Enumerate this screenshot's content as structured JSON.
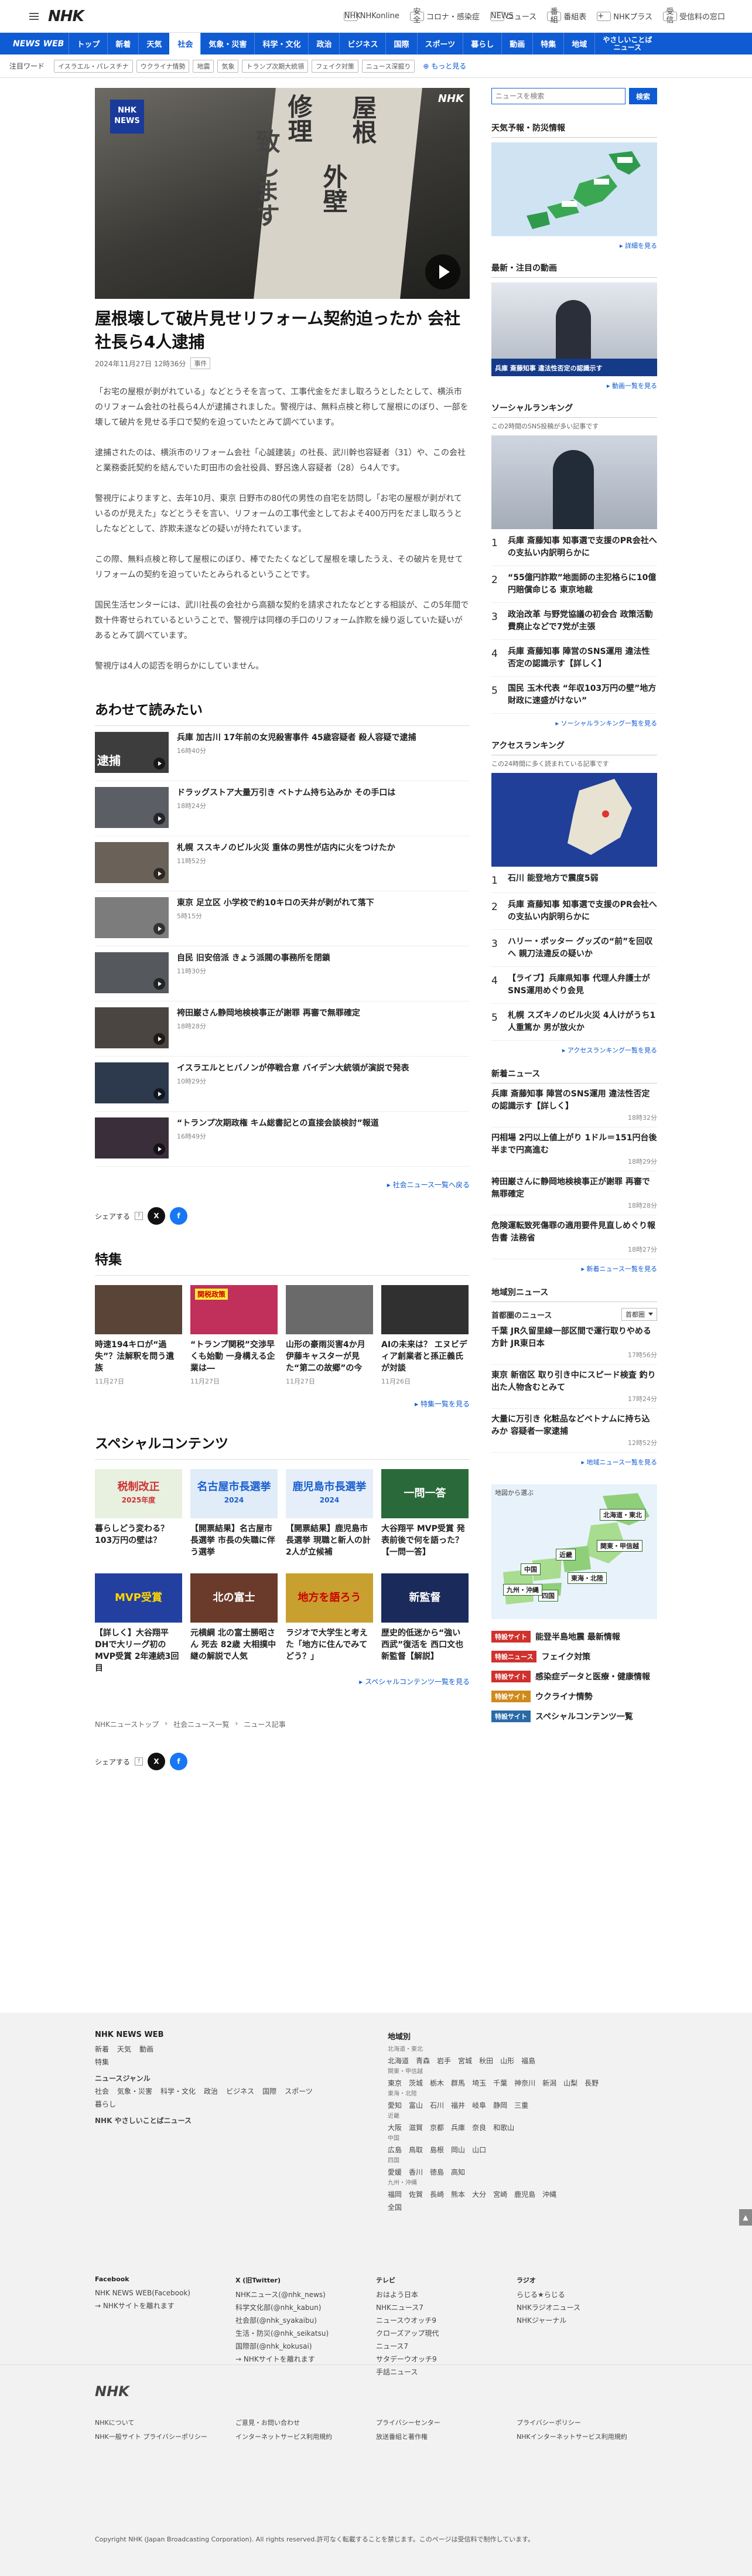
{
  "header": {
    "logo": "NHK",
    "links": [
      {
        "icon": "NHK",
        "label": "NHKonline"
      },
      {
        "icon": "安全",
        "label": "コロナ・感染症"
      },
      {
        "icon": "NEWS",
        "label": "ニュース"
      },
      {
        "icon": "番組",
        "label": "番組表"
      },
      {
        "icon": "+",
        "label": "NHKプラス"
      },
      {
        "icon": "受信",
        "label": "受信料の窓口"
      }
    ]
  },
  "nav": {
    "brand": "NEWS WEB",
    "items": [
      "トップ",
      "新着",
      "天気",
      "社会",
      "気象・災害",
      "科学・文化",
      "政治",
      "ビジネス",
      "国際",
      "スポーツ",
      "暮らし",
      "動画",
      "特集",
      "地域"
    ],
    "selected_index": 3,
    "easy": "やさしいことば\nニュース"
  },
  "trend": {
    "label": "注目ワード",
    "tags": [
      "イスラエル・パレスチナ",
      "ウクライナ情勢",
      "地震",
      "気象",
      "トランプ次期大統領",
      "フェイク対策",
      "ニュース深掘り"
    ],
    "more": "もっと見る"
  },
  "article": {
    "title": "屋根壊して破片見せリフォーム契約迫ったか 会社社長ら4人逮捕",
    "date": "2024年11月27日 12時36分",
    "category": "事件",
    "paragraphs": [
      "「お宅の屋根が剥がれている」などとうそを言って、工事代金をだまし取ろうとしたとして、横浜市のリフォーム会社の社長ら4人が逮捕されました。警視庁は、無料点検と称して屋根にのぼり、一部を壊して破片を見せる手口で契約を迫っていたとみて調べています。",
      "逮捕されたのは、横浜市のリフォーム会社「心誠建装」の社長、武川幹也容疑者（31）や、この会社と業務委託契約を結んでいた町田市の会社役員、野呂逸人容疑者（28）ら4人です。",
      "警視庁によりますと、去年10月、東京 日野市の80代の男性の自宅を訪問し「お宅の屋根が剥がれているのが見えた」などとうそを言い、リフォームの工事代金としておよそ400万円をだまし取ろうとしたなどとして、詐欺未遂などの疑いが持たれています。",
      "この際、無料点検と称して屋根にのぼり、棒でたたくなどして屋根を壊したうえ、その破片を見せてリフォームの契約を迫っていたとみられるということです。",
      "国民生活センターには、武川社長の会社から高額な契約を請求されたなどとする相談が、この5年間で数十件寄せられているということで、警視庁は同様の手口のリフォーム詐欺を繰り返していた疑いがあるとみて調べています。",
      "警視庁は4人の認否を明らかにしていません。"
    ],
    "hero_text": [
      "屋根",
      "外壁",
      "修理",
      "致します"
    ],
    "hero_wm": "NHK"
  },
  "related": {
    "heading": "あわせて読みたい",
    "items": [
      {
        "title": "兵庫 加古川 17年前の女児殺害事件 45歳容疑者 殺人容疑で逮捕",
        "date": "16時40分",
        "label": "逮捕"
      },
      {
        "title": "ドラッグストア大量万引き ベトナム持ち込みか その手口は",
        "date": "18時24分"
      },
      {
        "title": "札幌 ススキノのビル火災 重体の男性が店内に火をつけたか",
        "date": "11時52分"
      },
      {
        "title": "東京 足立区 小学校で約10キロの天井が剥がれて落下",
        "date": "5時15分"
      },
      {
        "title": "自民 旧安倍派 きょう派閥の事務所を閉鎖",
        "date": "11時30分"
      },
      {
        "title": "袴田巌さん静岡地検検事正が謝罪 再審で無罪確定",
        "date": "18時28分"
      },
      {
        "title": "イスラエルとヒバノンが停戦合意 バイデン大統領が演説で発表",
        "date": "10時29分"
      },
      {
        "title": "“トランプ次期政権 キム総書記との直接会談検討”報道",
        "date": "16時49分"
      }
    ],
    "more": "社会ニュース一覧へ戻る"
  },
  "share": {
    "label": "シェアする",
    "q": "?"
  },
  "features": {
    "heading": "特集",
    "items": [
      {
        "title": "時速194キロが“過失”？法解釈を問う遺族",
        "date": "11月27日"
      },
      {
        "title": "“トランプ関税”交渉早くも始動 一身構える企業は―",
        "date": "11月27日",
        "label": "関税政策"
      },
      {
        "title": "山形の豪雨災害4か月 伊藤キャスターが見た“第二の故郷”の今",
        "date": "11月27日"
      },
      {
        "title": "AIの未来は？ エヌビディア創業者と孫正義氏が対談",
        "date": "11月26日"
      }
    ],
    "more": "特集一覧を見る"
  },
  "special": {
    "heading": "スペシャルコンテンツ",
    "items": [
      {
        "title": "暮らしどう変わる？ 103万円の壁は？",
        "thumb": "税制改正",
        "sub": "2025年度"
      },
      {
        "title": "【開票結果】名古屋市長選挙 市長の失職に伴う選挙",
        "thumb": "名古屋市長選挙",
        "sub": "2024"
      },
      {
        "title": "【開票結果】鹿児島市長選挙 現職と新人の計2人が立候補",
        "thumb": "鹿児島市長選挙",
        "sub": "2024"
      },
      {
        "title": "大谷翔平 MVP受賞 発表前後で何を語った？【一問一答】",
        "thumb": "一問一答"
      },
      {
        "title": "【詳しく】大谷翔平 DHで大リーグ初のMVP受賞 2年連続3回目",
        "thumb": "MVP受賞"
      },
      {
        "title": "元横綱 北の富士勝昭さん 死去 82歳 大相撲中継の解説で人気",
        "thumb": "北の富士"
      },
      {
        "title": "ラジオで大学生と考えた「地方に住んでみてどう？」",
        "thumb": "地方を語ろう"
      },
      {
        "title": "歴史的低迷から“強い西武”復活を 西口文也新監督【解説】",
        "thumb": "新監督"
      }
    ],
    "more": "スペシャルコンテンツ一覧を見る"
  },
  "breadcrumb": [
    "NHKニューストップ",
    "社会ニュース一覧",
    "ニュース記事"
  ],
  "side": {
    "search_placeholder": "ニュースを検索",
    "search_btn": "検索",
    "weather": {
      "title": "天気予報・防災情報",
      "more": "詳細を見る"
    },
    "video": {
      "title": "最新・注目の動画",
      "caption": "兵庫 斎藤知事 違法性否定の認識示す",
      "more": "動画一覧を見る"
    },
    "social": {
      "title": "ソーシャルランキング",
      "note": "この2時間のSNS投稿が多い記事です",
      "items": [
        "兵庫 斎藤知事 知事選で支援のPR会社への支払い内訳明らかに",
        "“55億円詐欺”地面師の主犯格らに10億円賠償命じる 東京地裁",
        "政治改革 与野党協議の初会合 政策活動費廃止などで7党が主張",
        "兵庫 斎藤知事 陣営のSNS運用 違法性否定の認識示す【詳しく】",
        "国民 玉木代表 “年収103万円の壁”地方財政に速盛がけない”"
      ],
      "more": "ソーシャルランキング一覧を見る"
    },
    "access": {
      "title": "アクセスランキング",
      "note": "この24時間に多く読まれている記事です",
      "items": [
        "石川 能登地方で震度5弱",
        "兵庫 斎藤知事 知事選で支援のPR会社への支払い内訳明らかに",
        "ハリー・ポッター グッズの“前”を回収へ 親刀法違反の疑いか",
        "【ライブ】兵庫県知事 代理人弁護士がSNS運用めぐり会見",
        "札幌 スズキノのビル火災 4人けがうち1人重篤か 男が放火か"
      ],
      "more": "アクセスランキング一覧を見る"
    },
    "latest": {
      "title": "新着ニュース",
      "items": [
        {
          "title": "兵庫 斎藤知事 陣営のSNS運用 違法性否定の認識示す【詳しく】",
          "date": "18時32分"
        },
        {
          "title": "円相場 2円以上値上がり 1ドル＝151円台後半まで円高進む",
          "date": "18時29分"
        },
        {
          "title": "袴田巌さんに静岡地検検事正が謝罪 再審で無罪確定",
          "date": "18時28分"
        },
        {
          "title": "危険運転致死傷罪の適用要件見直しめぐり報告書 法務省",
          "date": "18時27分"
        }
      ],
      "more": "新着ニュース一覧を見る"
    },
    "regional": {
      "title": "地域別ニュース",
      "area": "首都圏のニュース",
      "select": "首都圏",
      "items": [
        {
          "title": "千葉 JR久留里線一部区間で運行取りやめる方針 JR東日本",
          "date": "17時56分"
        },
        {
          "title": "東京 新宿区 取り引き中にスピード検査 釣り出た人物含むとみて",
          "date": "17時24分"
        },
        {
          "title": "大量に万引き 化粧品などベトナムに持ち込みか 容疑者一家逮捕",
          "date": "12時52分"
        }
      ],
      "more": "地域ニュース一覧を見る"
    },
    "map_note": "地図から選ぶ",
    "map_regions": [
      "北海道・東北",
      "関東・甲信越",
      "東海・北陸",
      "近畿",
      "中国",
      "四国",
      "九州・沖縄"
    ],
    "topics": [
      {
        "badge": "特設サイト",
        "badge_color": "#d0312d",
        "title": "能登半島地震 最新情報"
      },
      {
        "badge": "特設ニュース",
        "badge_color": "#d0312d",
        "title": "フェイク対策"
      },
      {
        "badge": "特設サイト",
        "badge_color": "#d0312d",
        "title": "感染症データと医療・健康情報"
      },
      {
        "badge": "特設サイト",
        "badge_color": "#d08a1c",
        "title": "ウクライナ情勢"
      },
      {
        "badge": "特設サイト",
        "badge_color": "#2a6aa8",
        "title": "スペシャルコンテンツ一覧"
      }
    ]
  },
  "footer": {
    "left_title": "NHK NEWS WEB",
    "left_rows": [
      [
        "新着",
        "天気",
        "動画"
      ],
      [
        "特集"
      ],
      [
        "ニュースジャンル"
      ],
      [
        "社会",
        "気象・災害",
        "科学・文化",
        "政治",
        "ビジネス",
        "国際",
        "スポーツ"
      ],
      [
        "暮らし"
      ],
      [
        "NHK やさしいことばニュース"
      ]
    ],
    "region_title": "地域別",
    "regions": [
      {
        "h": "北海道・東北",
        "v": [
          "北海道",
          "青森",
          "岩手",
          "宮城",
          "秋田",
          "山形",
          "福島"
        ]
      },
      {
        "h": "関東・甲信越",
        "v": [
          "東京",
          "茨城",
          "栃木",
          "群馬",
          "埼玉",
          "千葉",
          "神奈川",
          "新潟",
          "山梨",
          "長野"
        ]
      },
      {
        "h": "東海・北陸",
        "v": [
          "愛知",
          "富山",
          "石川",
          "福井",
          "岐阜",
          "静岡",
          "三重"
        ]
      },
      {
        "h": "近畿",
        "v": [
          "大阪",
          "滋賀",
          "京都",
          "兵庫",
          "奈良",
          "和歌山"
        ]
      },
      {
        "h": "中国",
        "v": [
          "広島",
          "鳥取",
          "島根",
          "岡山",
          "山口"
        ]
      },
      {
        "h": "四国",
        "v": [
          "愛媛",
          "香川",
          "徳島",
          "高知"
        ]
      },
      {
        "h": "九州・沖縄",
        "v": [
          "福岡",
          "佐賀",
          "長崎",
          "熊本",
          "大分",
          "宮崎",
          "鹿児島",
          "沖縄"
        ]
      },
      {
        "h": "",
        "v": [
          "全国"
        ]
      }
    ],
    "sns": [
      {
        "h": "Facebook",
        "v": [
          "NHK NEWS WEB(Facebook)",
          "→ NHKサイトを離れます"
        ]
      },
      {
        "h": "X (旧Twitter)",
        "v": [
          "NHKニュース(@nhk_news)",
          "科学文化部(@nhk_kabun)",
          "社会部(@nhk_syakaibu)",
          "生活・防災(@nhk_seikatsu)",
          "国際部(@nhk_kokusai)",
          "→ NHKサイトを離れます"
        ]
      },
      {
        "h": "テレビ",
        "v": [
          "おはよう日本",
          "NHKニュース7",
          "ニュースウオッチ9",
          "クローズアップ現代",
          "ニュース7",
          "サタデーウオッチ9",
          "手話ニュース"
        ]
      },
      {
        "h": "ラジオ",
        "v": [
          "らじる★らじる",
          "NHKラジオニュース",
          "NHKジャーナル"
        ]
      }
    ],
    "bottom_logo": "NHK",
    "bottom_links": [
      "NHKについて",
      "ご意見・お問い合わせ",
      "プライバシーセンター",
      "プライバシーポリシー",
      "NHK一般サイト プライバシーポリシー",
      "インターネットサービス利用規約",
      "放送番組と著作権",
      "NHKインターネットサービス利用規約"
    ],
    "copyright": "Copyright NHK (Japan Broadcasting Corporation). All rights reserved.許可なく転載することを禁じます。このページは受信料で制作しています。"
  }
}
